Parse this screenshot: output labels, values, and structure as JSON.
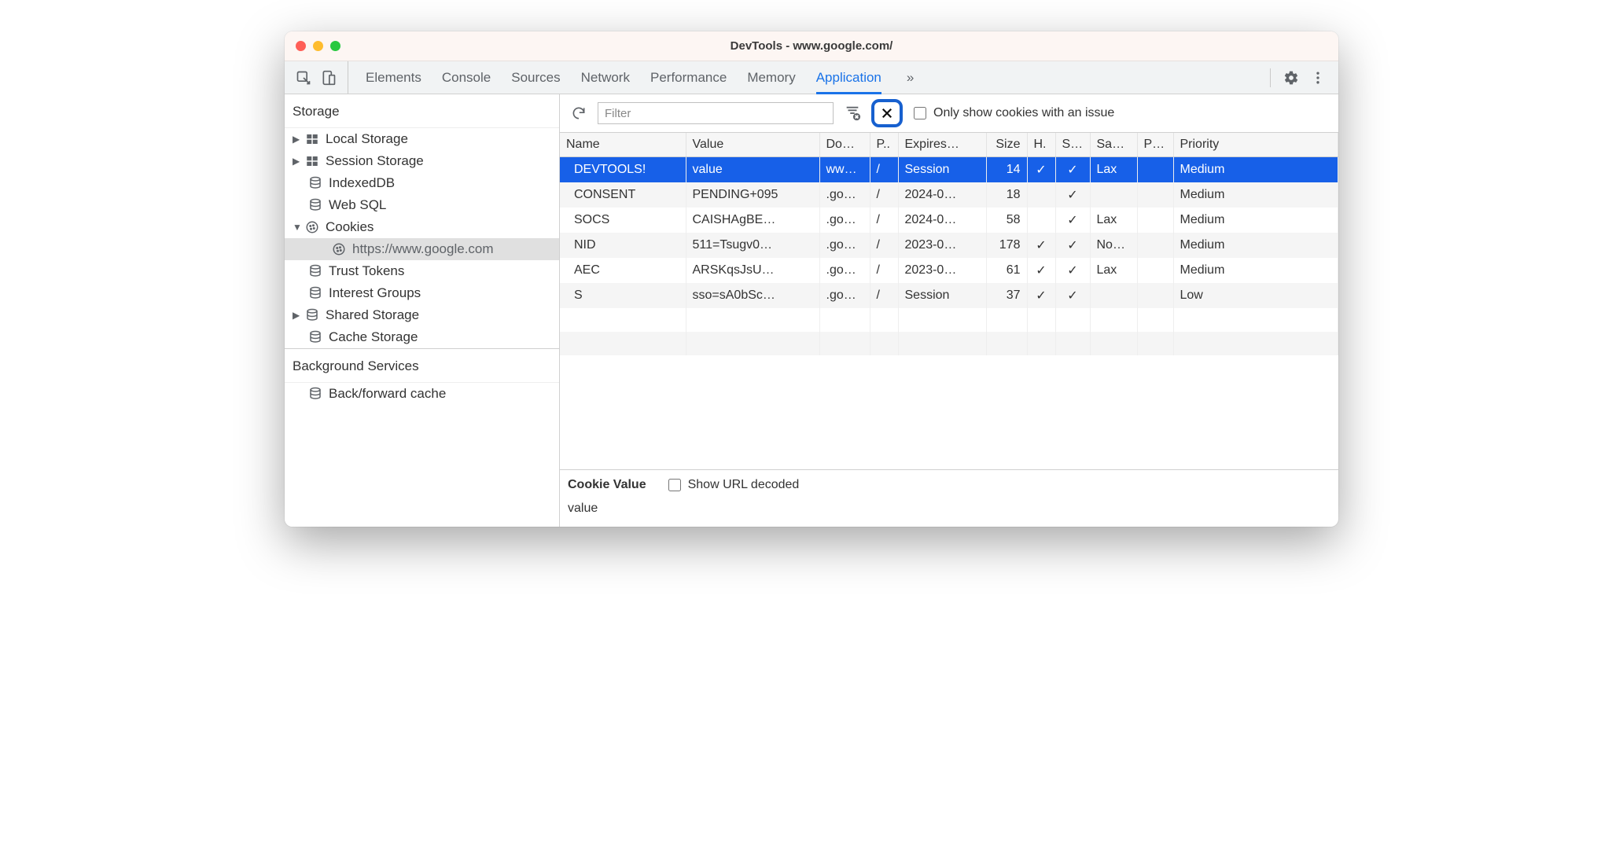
{
  "window": {
    "title": "DevTools - www.google.com/"
  },
  "tabs": {
    "items": [
      "Elements",
      "Console",
      "Sources",
      "Network",
      "Performance",
      "Memory",
      "Application"
    ],
    "active": "Application",
    "overflow": "»"
  },
  "sidebar": {
    "section_storage": "Storage",
    "section_services": "Background Services",
    "items": {
      "local_storage": "Local Storage",
      "session_storage": "Session Storage",
      "indexeddb": "IndexedDB",
      "web_sql": "Web SQL",
      "cookies": "Cookies",
      "cookies_domain": "https://www.google.com",
      "trust_tokens": "Trust Tokens",
      "interest_groups": "Interest Groups",
      "shared_storage": "Shared Storage",
      "cache_storage": "Cache Storage",
      "bf_cache": "Back/forward cache"
    }
  },
  "filterbar": {
    "filter_placeholder": "Filter",
    "only_issues": "Only show cookies with an issue"
  },
  "table": {
    "headers": {
      "name": "Name",
      "value": "Value",
      "domain": "Do…",
      "path": "P..",
      "expires": "Expires…",
      "size": "Size",
      "httponly": "H.",
      "secure": "S…",
      "samesite": "Sa…",
      "partition": "P…",
      "priority": "Priority"
    },
    "rows": [
      {
        "name": "DEVTOOLS!",
        "value": "value",
        "domain": "ww…",
        "path": "/",
        "expires": "Session",
        "size": "14",
        "httponly": "✓",
        "secure": "✓",
        "samesite": "Lax",
        "partition": "",
        "priority": "Medium",
        "selected": true
      },
      {
        "name": "CONSENT",
        "value": "PENDING+095",
        "domain": ".go…",
        "path": "/",
        "expires": "2024-0…",
        "size": "18",
        "httponly": "",
        "secure": "✓",
        "samesite": "",
        "partition": "",
        "priority": "Medium"
      },
      {
        "name": "SOCS",
        "value": "CAISHAgBE…",
        "domain": ".go…",
        "path": "/",
        "expires": "2024-0…",
        "size": "58",
        "httponly": "",
        "secure": "✓",
        "samesite": "Lax",
        "partition": "",
        "priority": "Medium"
      },
      {
        "name": "NID",
        "value": "511=Tsugv0…",
        "domain": ".go…",
        "path": "/",
        "expires": "2023-0…",
        "size": "178",
        "httponly": "✓",
        "secure": "✓",
        "samesite": "No…",
        "partition": "",
        "priority": "Medium"
      },
      {
        "name": "AEC",
        "value": "ARSKqsJsU…",
        "domain": ".go…",
        "path": "/",
        "expires": "2023-0…",
        "size": "61",
        "httponly": "✓",
        "secure": "✓",
        "samesite": "Lax",
        "partition": "",
        "priority": "Medium"
      },
      {
        "name": "S",
        "value": "sso=sA0bSc…",
        "domain": ".go…",
        "path": "/",
        "expires": "Session",
        "size": "37",
        "httponly": "✓",
        "secure": "✓",
        "samesite": "",
        "partition": "",
        "priority": "Low"
      }
    ]
  },
  "details": {
    "title": "Cookie Value",
    "decode_label": "Show URL decoded",
    "value": "value"
  }
}
